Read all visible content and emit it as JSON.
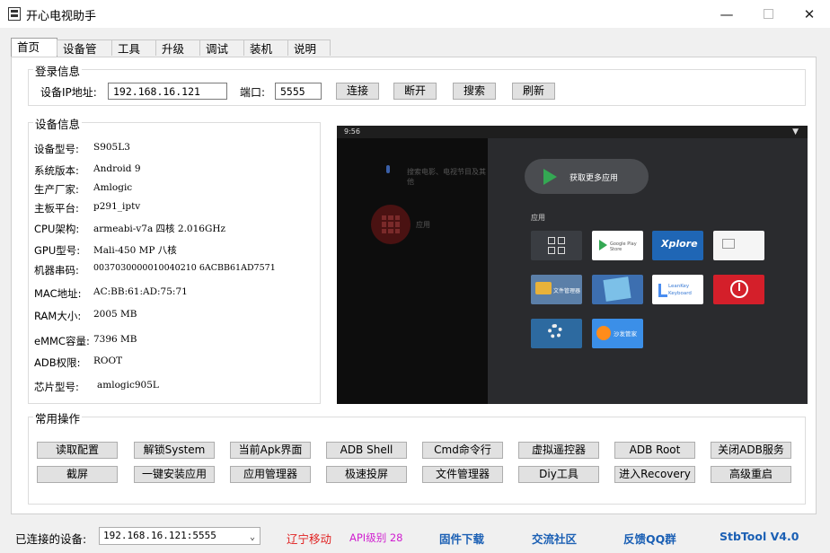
{
  "window": {
    "title": "开心电视助手",
    "min": "—",
    "close": "✕"
  },
  "tabs": [
    "首页",
    "设备管理",
    "工具箱",
    "升级",
    "调试",
    "装机",
    "说明"
  ],
  "login": {
    "group_title": "登录信息",
    "ip_label": "设备IP地址:",
    "ip_value": "192.168.16.121",
    "port_label": "端口:",
    "port_value": "5555",
    "buttons": [
      "连接",
      "断开",
      "搜索",
      "刷新"
    ]
  },
  "device_info": {
    "group_title": "设备信息",
    "rows": [
      {
        "label": "设备型号:",
        "value": "S905L3"
      },
      {
        "label": "系统版本:",
        "value": "Android 9"
      },
      {
        "label": "生产厂家:",
        "value": "Amlogic"
      },
      {
        "label": "主板平台:",
        "value": "p291_iptv"
      },
      {
        "label": "CPU架构:",
        "value": "armeabi-v7a 四核 2.016GHz"
      },
      {
        "label": "GPU型号:",
        "value": "Mali-450 MP 八核"
      },
      {
        "label": "机器串码:",
        "value": "0037030000010040210 6ACBB61AD7571"
      },
      {
        "label": "MAC地址:",
        "value": "AC:BB:61:AD:75:71"
      },
      {
        "label": "RAM大小:",
        "value": "2005 MB"
      },
      {
        "label": "eMMC容量:",
        "value": "7396 MB"
      },
      {
        "label": "ADB权限:",
        "value": "ROOT"
      },
      {
        "label": "芯片型号:",
        "value": "amlogic905L"
      }
    ]
  },
  "tv_screen": {
    "time": "9:56",
    "wifi_icon": "wifi-icon",
    "search_hint": "搜索电影、电视节目及其他",
    "left_app_label": "应用",
    "play_store_label": "获取更多应用",
    "apps_label": "应用",
    "tiles": [
      {
        "name": "apps",
        "label": "",
        "color": "#3a3d42"
      },
      {
        "name": "google-play-store",
        "label": "Google Play Store",
        "color": "#ffffff"
      },
      {
        "name": "xplore",
        "label": "Xplore",
        "color": "#1f66b5"
      },
      {
        "name": "airplay",
        "label": "",
        "color": "#f5f5f5"
      },
      {
        "name": "file-manager",
        "label": "文件管理器",
        "color": "#5b7fa8"
      },
      {
        "name": "gallery",
        "label": "",
        "color": "#3d6fb0"
      },
      {
        "name": "leanback-keyboard",
        "label": "LeanKey Keyboard",
        "color": "#ffffff"
      },
      {
        "name": "power",
        "label": "",
        "color": "#d41f2a"
      },
      {
        "name": "settings",
        "label": "",
        "color": "#2d6aa0"
      },
      {
        "name": "sofa-butler",
        "label": "沙发管家",
        "color": "#3b8fe8"
      }
    ]
  },
  "ops": {
    "group_title": "常用操作",
    "row1": [
      "读取配置",
      "解锁System",
      "当前Apk界面",
      "ADB Shell",
      "Cmd命令行",
      "虚拟遥控器",
      "ADB  Root",
      "关闭ADB服务"
    ],
    "row2": [
      "截屏",
      "一键安装应用",
      "应用管理器",
      "极速投屏",
      "文件管理器",
      "Diy工具",
      "进入Recovery",
      "高级重启"
    ]
  },
  "statusbar": {
    "connected_label": "已连接的设备:",
    "connected_value": "192.168.16.121:5555",
    "province": "辽宁移动",
    "api_level": "API级别 28",
    "firmware": "固件下载",
    "community": "交流社区",
    "feedback": "反馈QQ群",
    "version": "StbTool V4.0"
  }
}
